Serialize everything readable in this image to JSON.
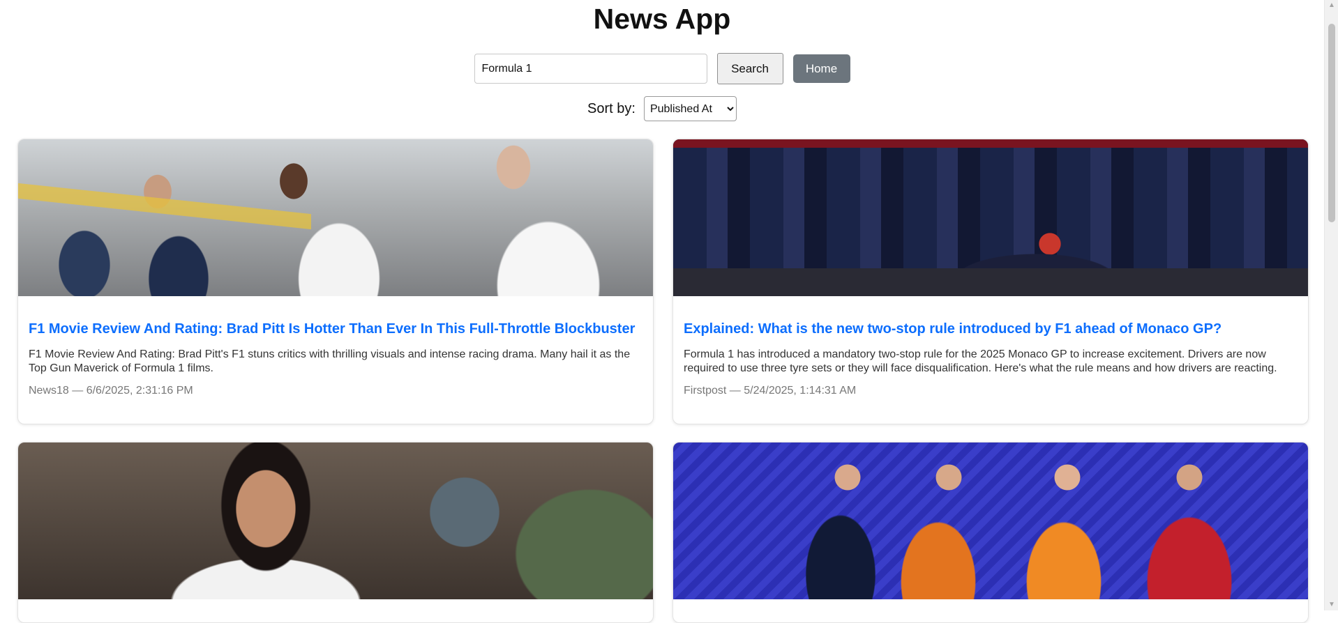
{
  "header": {
    "title": "News App"
  },
  "search": {
    "value": "Formula 1",
    "button_label": "Search",
    "home_label": "Home"
  },
  "sort": {
    "label": "Sort by:",
    "selected": "Published At"
  },
  "articles": [
    {
      "title": "F1 Movie Review And Rating: Brad Pitt Is Hotter Than Ever In This Full-Throttle Blockbuster",
      "description": "F1 Movie Review And Rating: Brad Pitt's F1 stuns critics with thrilling visuals and intense racing drama. Many hail it as the Top Gun Maverick of Formula 1 films.",
      "meta": "News18 — 6/6/2025, 2:31:16 PM"
    },
    {
      "title": "Explained: What is the new two-stop rule introduced by F1 ahead of Monaco GP?",
      "description": "Formula 1 has introduced a mandatory two-stop rule for the 2025 Monaco GP to increase excitement. Drivers are now required to use three tyre sets or they will face disqualification. Here's what the rule means and how drivers are reacting.",
      "meta": "Firstpost — 5/24/2025, 1:14:31 AM"
    },
    {
      "title": "",
      "description": "",
      "meta": ""
    },
    {
      "title": "",
      "description": "",
      "meta": ""
    }
  ],
  "colors": {
    "link": "#0d6efd",
    "home_button": "#6c757d",
    "meta_text": "#777777"
  }
}
